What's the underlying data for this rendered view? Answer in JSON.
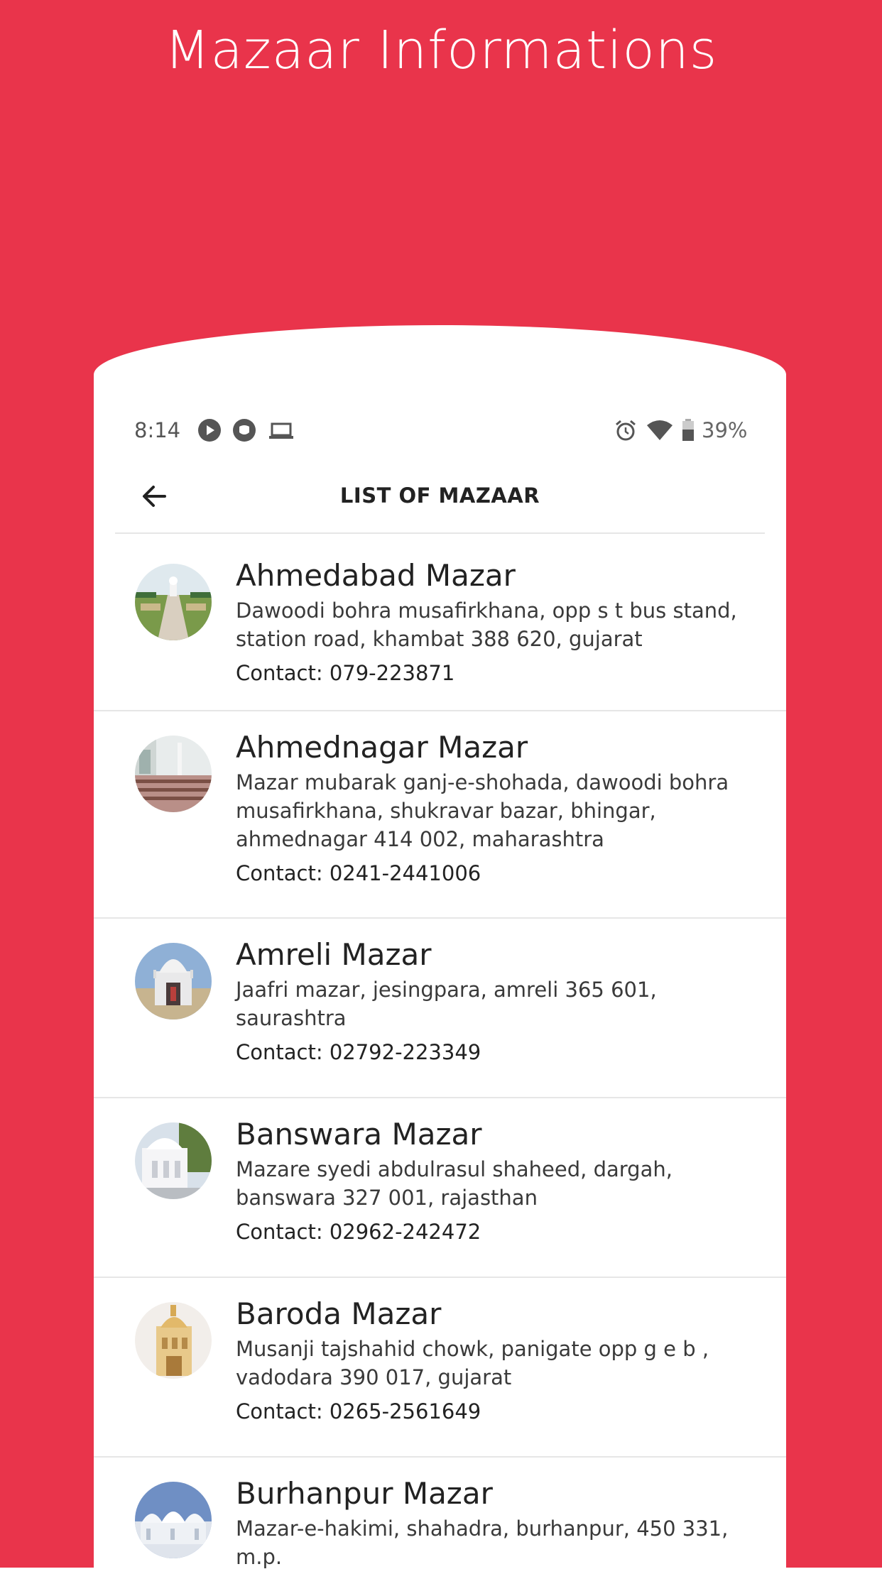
{
  "promo": {
    "title": "Mazaar Informations",
    "background_color": "#e9344b"
  },
  "status_bar": {
    "time": "8:14",
    "battery_percent": "39%",
    "icons": [
      "play-icon",
      "app-notification-icon",
      "laptop-icon",
      "alarm-icon",
      "wifi-icon",
      "battery-icon"
    ]
  },
  "app_bar": {
    "title": "LIST OF MAZAAR",
    "back_icon": "arrow-left-icon"
  },
  "mazaars": [
    {
      "name": "Ahmedabad Mazar",
      "address": "Dawoodi bohra musafirkhana, opp  s  t  bus stand, station road, khambat 388 620, gujarat",
      "contact": "Contact: 079-223871"
    },
    {
      "name": "Ahmednagar Mazar",
      "address": "Mazar mubarak ganj-e-shohada, dawoodi bohra musafirkhana, shukravar bazar, bhingar, ahmednagar 414 002, maharashtra",
      "contact": "Contact: 0241-2441006"
    },
    {
      "name": "Amreli Mazar",
      "address": "Jaafri mazar, jesingpara, amreli 365 601, saurashtra",
      "contact": "Contact: 02792-223349"
    },
    {
      "name": "Banswara Mazar",
      "address": "Mazare syedi abdulrasul shaheed, dargah, banswara 327 001, rajasthan",
      "contact": "Contact: 02962-242472"
    },
    {
      "name": "Baroda Mazar",
      "address": "Musanji tajshahid chowk, panigate opp  g e b , vadodara  390 017, gujarat",
      "contact": "Contact: 0265-2561649"
    },
    {
      "name": "Burhanpur Mazar",
      "address": "Mazar-e-hakimi, shahadra, burhanpur, 450 331, m.p.",
      "contact": ""
    }
  ]
}
